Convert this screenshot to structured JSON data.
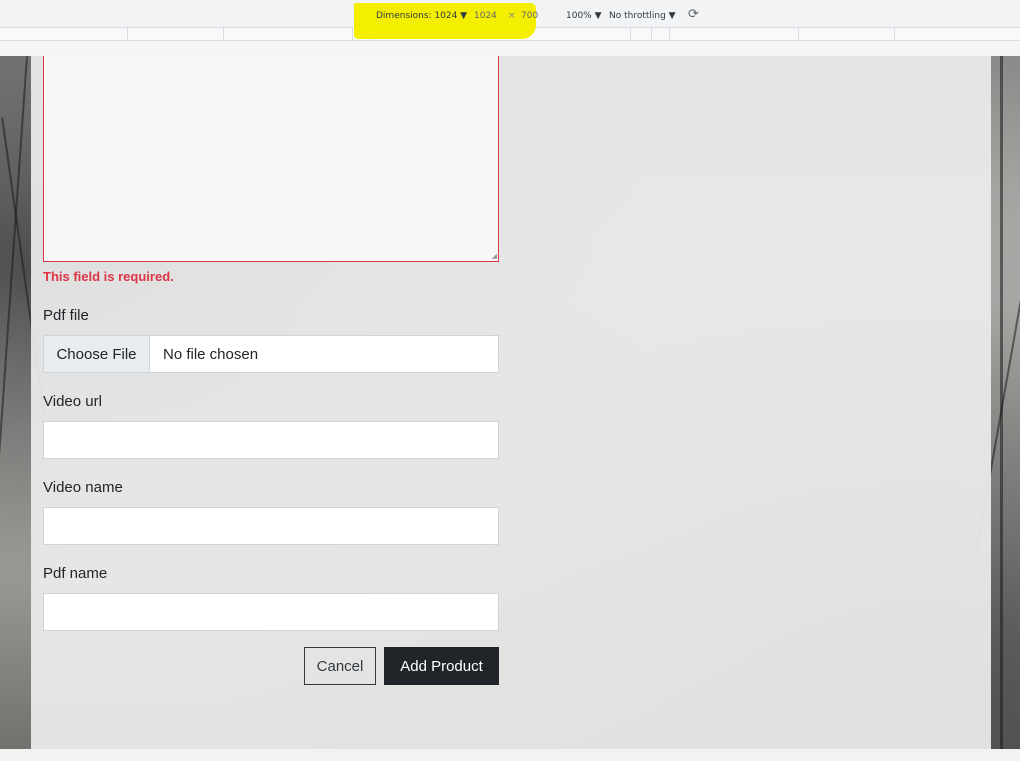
{
  "devtools": {
    "dimensions_label": "Dimensions: 1024 ▼",
    "width_value": "1024",
    "times_symbol": "×",
    "height_value": "700",
    "zoom_label": "100% ▼",
    "throttling_label": "No throttling ▼",
    "rotate_icon": "rotate-icon",
    "highlight_color": "#f4ee00"
  },
  "form": {
    "description_error": "This field is required.",
    "pdf_file_label": "Pdf file",
    "choose_file_label": "Choose File",
    "no_file_text": "No file chosen",
    "video_url_label": "Video url",
    "video_url_value": "",
    "video_name_label": "Video name",
    "video_name_value": "",
    "pdf_name_label": "Pdf name",
    "pdf_name_value": "",
    "cancel_label": "Cancel",
    "submit_label": "Add Product"
  },
  "colors": {
    "error": "#dc3545",
    "primary_button": "#212529"
  }
}
